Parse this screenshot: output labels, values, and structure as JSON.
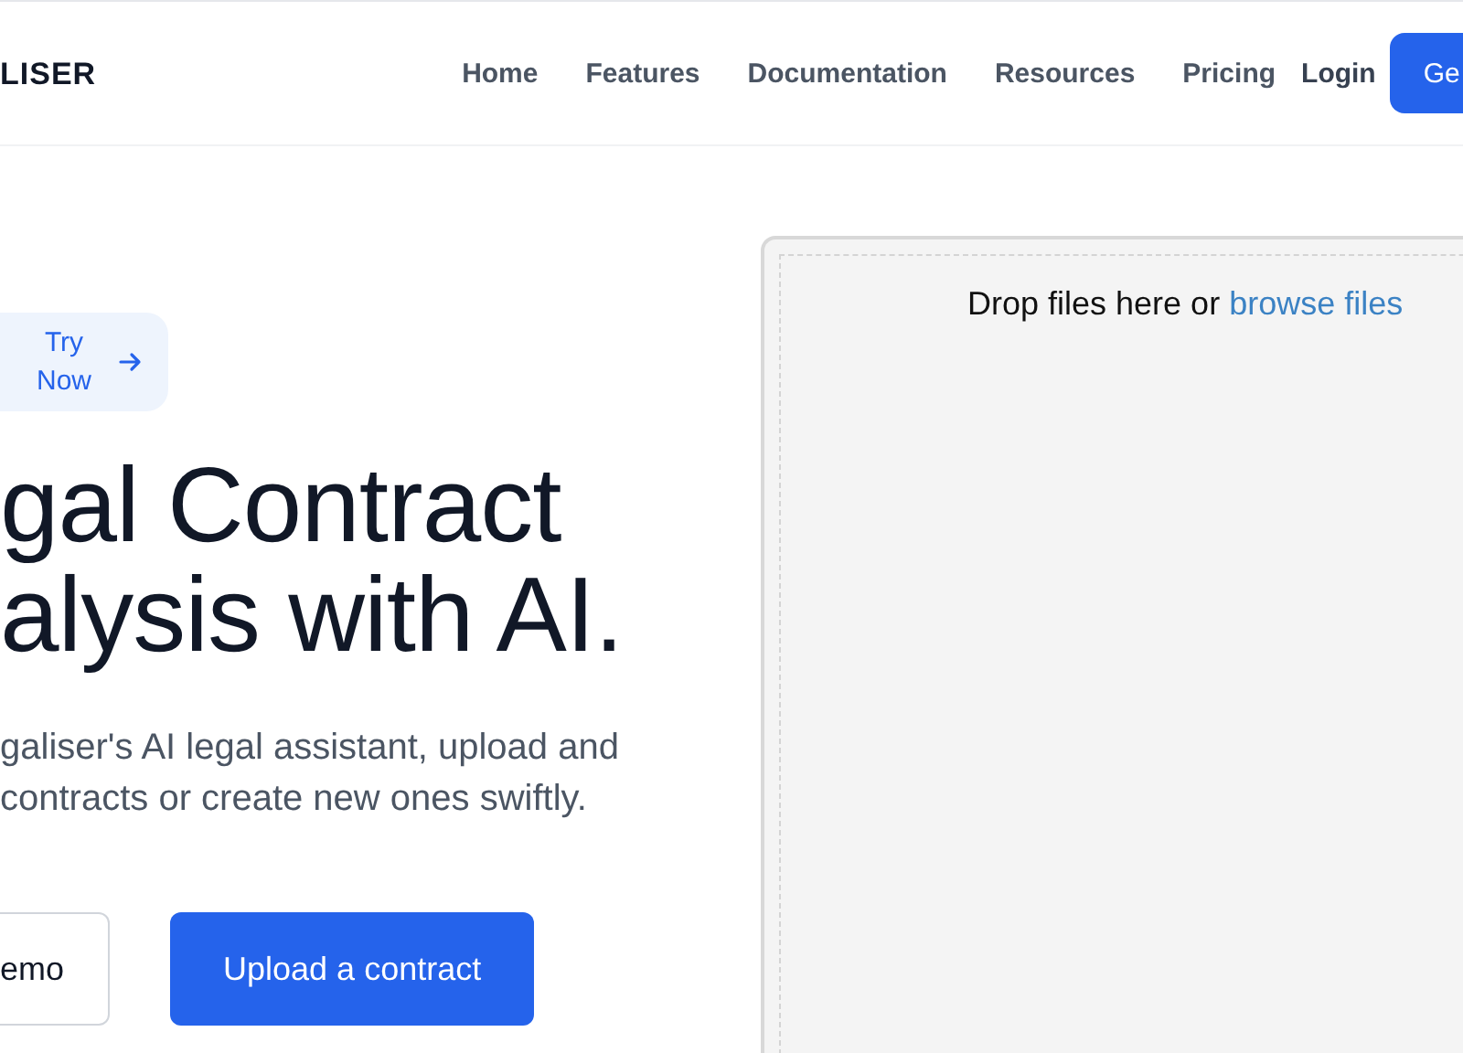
{
  "header": {
    "logo": "LISER",
    "nav": [
      "Home",
      "Features",
      "Documentation",
      "Resources",
      "Pricing"
    ],
    "login": "Login",
    "cta": "Ge"
  },
  "hero": {
    "badge": "Try\nNow",
    "heading": "gal Contract\nalysis with AI.",
    "description": "galiser's AI legal assistant, upload and\ncontracts or create new ones swiftly.",
    "buttons": [
      {
        "label": "emo",
        "kind": "secondary"
      },
      {
        "label": "Upload a contract",
        "kind": "primary"
      }
    ]
  },
  "dropzone": {
    "text": "Drop files here or ",
    "link": "browse files"
  }
}
